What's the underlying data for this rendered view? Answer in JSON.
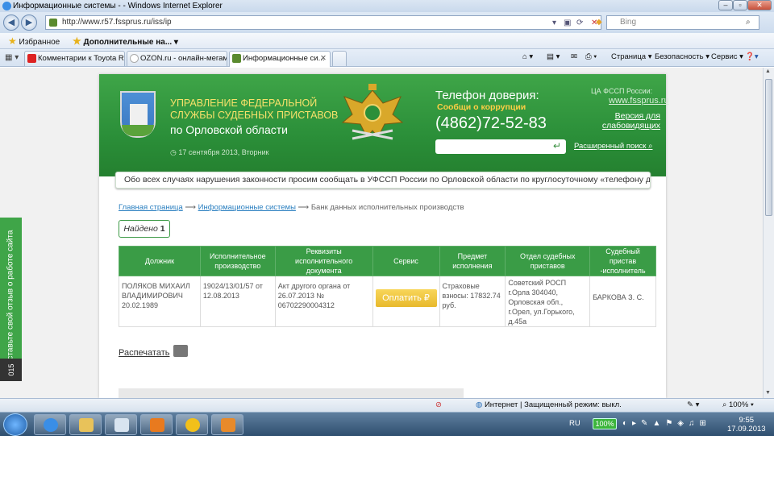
{
  "browser": {
    "window_title": "Информационные системы - - Windows Internet Explorer",
    "url": "http://www.r57.fssprus.ru/iss/ip",
    "search_placeholder": "Bing",
    "favorites_label": "Избранное",
    "favorites_item": "Дополнительные на...",
    "tabs": [
      {
        "label": "Комментарии к Toyota R..."
      },
      {
        "label": "OZON.ru - онлайн-мегам..."
      },
      {
        "label": "Информационные си..."
      }
    ],
    "commands": [
      "Страница",
      "Безопасность",
      "Сервис"
    ],
    "status_zone": "Интернет | Защищенный режим: выкл.",
    "zoom": "100%"
  },
  "site": {
    "agency_line1": "Управление Федеральной службы судебных приставов",
    "agency_line2": "по Орловской области",
    "date": "17 сентября 2013, Вторник",
    "hotline_title": "Телефон доверия:",
    "corruption": "Сообщи о коррупции",
    "phone": "(4862)72-52-83",
    "ca_label": "ЦА ФССП России:",
    "ca_link": "www.fssprus.ru",
    "weak_version": "Версия для слабовидящих",
    "advanced_search": "Расширенный поиск",
    "ticker": "Обо всех случаях нарушения законности просим сообщать в УФССП России по Орловской области по круглосуточному «телефону дов",
    "breadcrumbs": {
      "home": "Главная страница",
      "sep": "⟶",
      "systems": "Информационные системы",
      "current": "Банк данных исполнительных производств"
    },
    "found_label": "Найдено",
    "found_count": "1",
    "table": {
      "headers": [
        "Должник",
        "Исполнительное производство",
        "Реквизиты исполнительного документа",
        "Сервис",
        "Предмет исполнения",
        "Отдел судебных приставов",
        "Судебный пристав -исполнитель"
      ],
      "row": {
        "debtor": "ПОЛЯКОВ МИХАИЛ ВЛАДИМИРОВИЧ 20.02.1989",
        "proceeding": "19024/13/01/57 от 12.08.2013",
        "document": "Акт другого органа от 26.07.2013 № 06702290004312",
        "pay_button": "Оплатить ₽",
        "subject": "Страховые взносы: 17832.74 руб.",
        "department": "Советский РОСП г.Орла 304040, Орловская обл., г.Орел, ул.Горького, д.45а",
        "bailiff": "БАРКОВА З. С."
      }
    },
    "print": "Распечатать",
    "feedback_tab": "Оставьте свой отзыв о работе сайта",
    "feedback_badge": "015"
  },
  "taskbar": {
    "lang": "RU",
    "battery": "100%",
    "time": "9:55",
    "date": "17.09.2013"
  },
  "colors": {
    "header_green": "#2b8f39",
    "table_green": "#3a9c46",
    "pay_yellow": "#e8b92c",
    "link_blue": "#2a7fc0"
  }
}
